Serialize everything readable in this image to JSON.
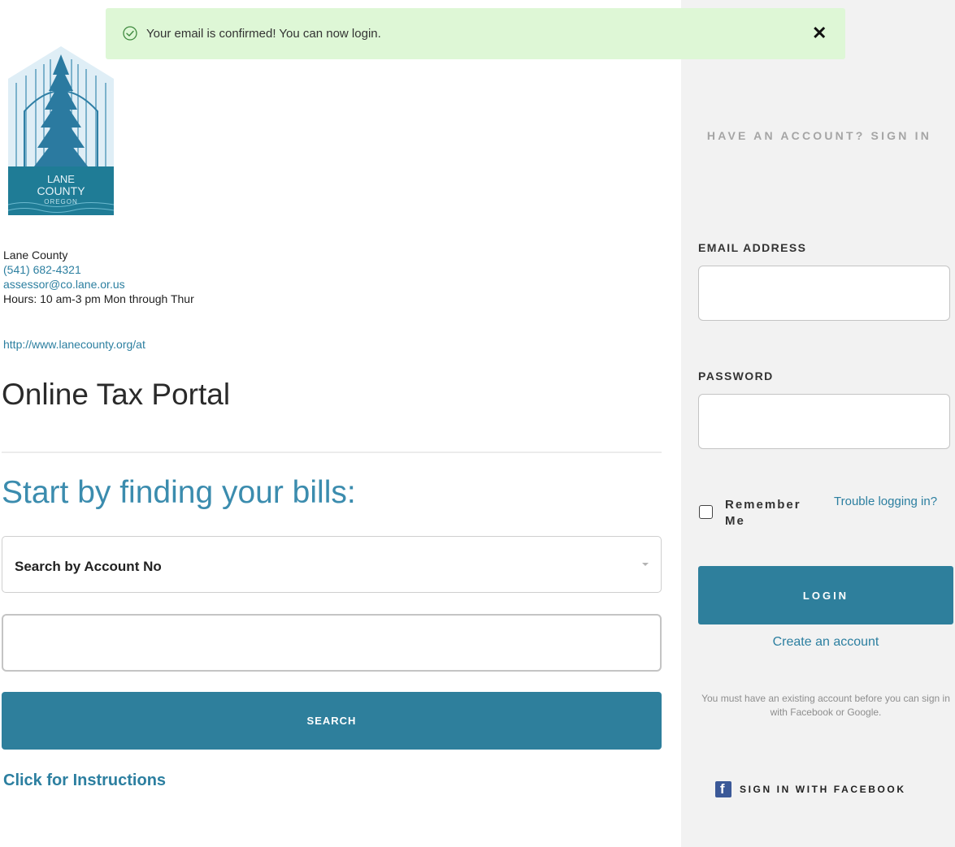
{
  "toast": {
    "message": "Your email is confirmed! You can now login.",
    "close_glyph": "✕",
    "icon": "check-circle-icon",
    "background": "#def7d6"
  },
  "logo": {
    "line1": "LANE",
    "line2": "COUNTY",
    "line3": "OREGON"
  },
  "contact": {
    "organization": "Lane County",
    "phone": "(541) 682-4321",
    "email": "assessor@co.lane.or.us",
    "hours": "Hours: 10 am-3 pm Mon through Thur",
    "website": "http://www.lanecounty.org/at"
  },
  "main": {
    "title": "Online Tax Portal",
    "find_heading": "Start by finding your bills:",
    "search_select_label": "Search by Account No",
    "search_button": "SEARCH",
    "instructions_link": "Click for Instructions"
  },
  "signin": {
    "heading": "HAVE AN ACCOUNT? SIGN IN",
    "email_label": "EMAIL ADDRESS",
    "password_label": "PASSWORD",
    "remember_label": "Remember Me",
    "trouble_link": "Trouble logging in?",
    "login_button": "LOGIN",
    "create_link": "Create an account",
    "social_note": "You must have an existing account before you can sign in with Facebook or Google.",
    "facebook_button": "SIGN IN WITH FACEBOOK",
    "facebook_icon": "facebook-icon"
  },
  "colors": {
    "accent": "#2e7f9c",
    "link": "#2c7fa0",
    "heading_blue": "#3b8cae",
    "panel_bg": "#f2f2f2"
  }
}
